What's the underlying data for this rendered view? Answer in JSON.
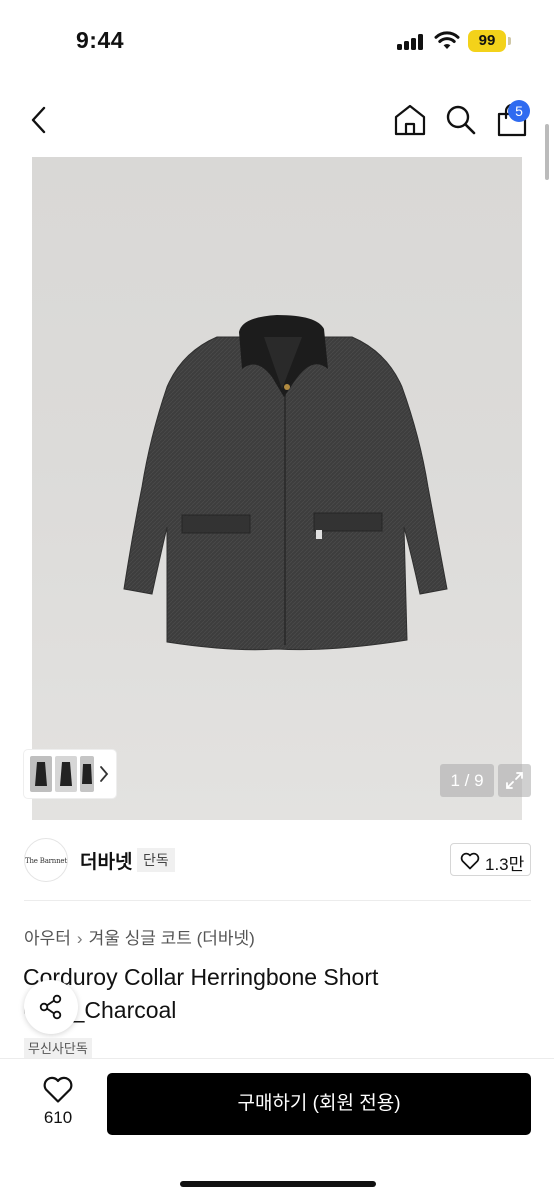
{
  "status_bar": {
    "time": "9:44",
    "battery": "99"
  },
  "nav": {
    "cart_count": "5"
  },
  "gallery": {
    "page_counter": "1 / 9"
  },
  "brand": {
    "logo_text": "The Barnnet",
    "name": "더바넷",
    "tag": "단독",
    "likes": "1.3만"
  },
  "breadcrumb": {
    "items": [
      "아우터",
      "겨울 싱글 코트 (더바넷)"
    ]
  },
  "product": {
    "title": "Corduroy Collar Herringbone Short Coat_Charcoal",
    "badge": "무신사단독"
  },
  "bottom_bar": {
    "wish_count": "610",
    "buy_label": "구매하기 (회원 전용)"
  },
  "colors": {
    "accent": "#2f6bf0",
    "battery": "#f3d21a",
    "buy_button": "#000000"
  }
}
